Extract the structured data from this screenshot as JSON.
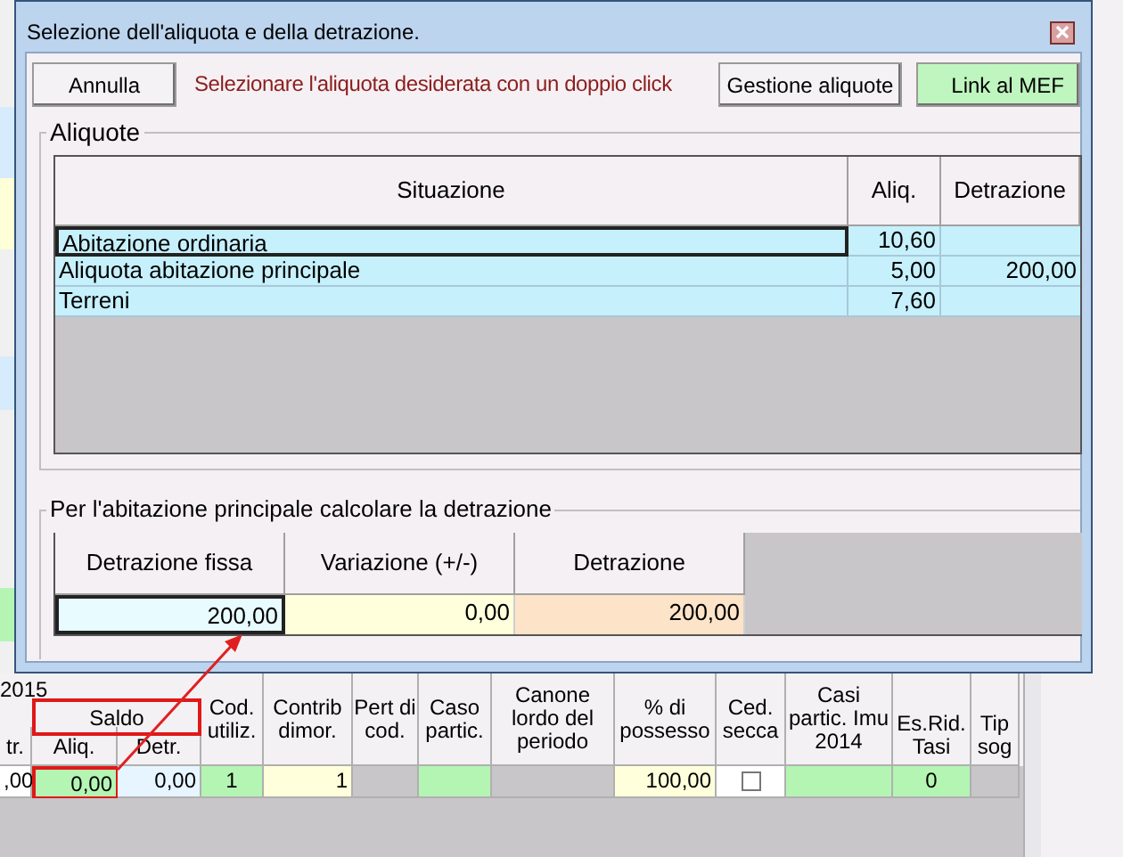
{
  "background": {
    "year_label": "2015",
    "group_header": "Saldo",
    "columns": [
      {
        "label": "tr."
      },
      {
        "label": "Aliq."
      },
      {
        "label": "Detr."
      },
      {
        "label": "Cod. utiliz."
      },
      {
        "label": "Contrib dimor."
      },
      {
        "label": "Pert di cod."
      },
      {
        "label": "Caso partic."
      },
      {
        "label": "Canone lordo del periodo"
      },
      {
        "label": "% di possesso"
      },
      {
        "label": "Ced. secca"
      },
      {
        "label": "Casi partic. Imu 2014"
      },
      {
        "label": "Es.Rid. Tasi"
      },
      {
        "label": "Tip sog"
      }
    ],
    "row": [
      {
        "kind": "text",
        "value": ",00",
        "color": "#ffffff"
      },
      {
        "kind": "text",
        "value": "0,00",
        "color": "#b4f5b4",
        "highlighted": true
      },
      {
        "kind": "text",
        "value": "0,00",
        "color": "#e6f5ff"
      },
      {
        "kind": "text",
        "value": "1",
        "color": "#b4f5b4"
      },
      {
        "kind": "text",
        "value": "1",
        "color": "#ffffdc"
      },
      {
        "kind": "text",
        "color": "#c8c6c8"
      },
      {
        "kind": "text",
        "color": "#b4f5b4"
      },
      {
        "kind": "text",
        "color": "#c8c6c8"
      },
      {
        "kind": "text",
        "value": "100,00",
        "color": "#ffffdc"
      },
      {
        "kind": "checkbox",
        "checked": false,
        "color": "#ffffff"
      },
      {
        "kind": "text",
        "color": "#b4f5b4"
      },
      {
        "kind": "text",
        "value": "0",
        "color": "#b4f5b4"
      },
      {
        "kind": "text",
        "color": "#c8c6c8"
      }
    ]
  },
  "dialog": {
    "title": "Selezione dell'aliquota e della detrazione.",
    "buttons": [
      {
        "label": "Annulla",
        "kind": "plain"
      },
      {
        "label": "Gestione aliquote",
        "kind": "plain"
      },
      {
        "label": "Link al MEF",
        "kind": "link"
      }
    ],
    "message": "Selezionare l'aliquota desiderata con un doppio click",
    "aliquote": {
      "legend": "Aliquote",
      "columns": [
        "Situazione",
        "Aliq.",
        "Detrazione"
      ],
      "rows": [
        {
          "situazione": "Abitazione ordinaria",
          "aliq": "10,60",
          "selected": true
        },
        {
          "situazione": "Aliquota abitazione principale",
          "aliq": "5,00",
          "detrazione": "200,00",
          "selected": false
        },
        {
          "situazione": "Terreni",
          "aliq": "7,60",
          "selected": false
        }
      ]
    },
    "detrazione": {
      "legend": "Per l'abitazione principale calcolare la detrazione",
      "columns": [
        {
          "label": "Detrazione fissa",
          "value": "200,00",
          "color": "#e8fbff",
          "selected": true
        },
        {
          "label": "Variazione (+/-)",
          "value": "0,00",
          "color": "#ffffdc",
          "selected": false
        },
        {
          "label": "Detrazione",
          "value": "200,00",
          "color": "#fde3c8",
          "selected": false
        }
      ]
    }
  }
}
